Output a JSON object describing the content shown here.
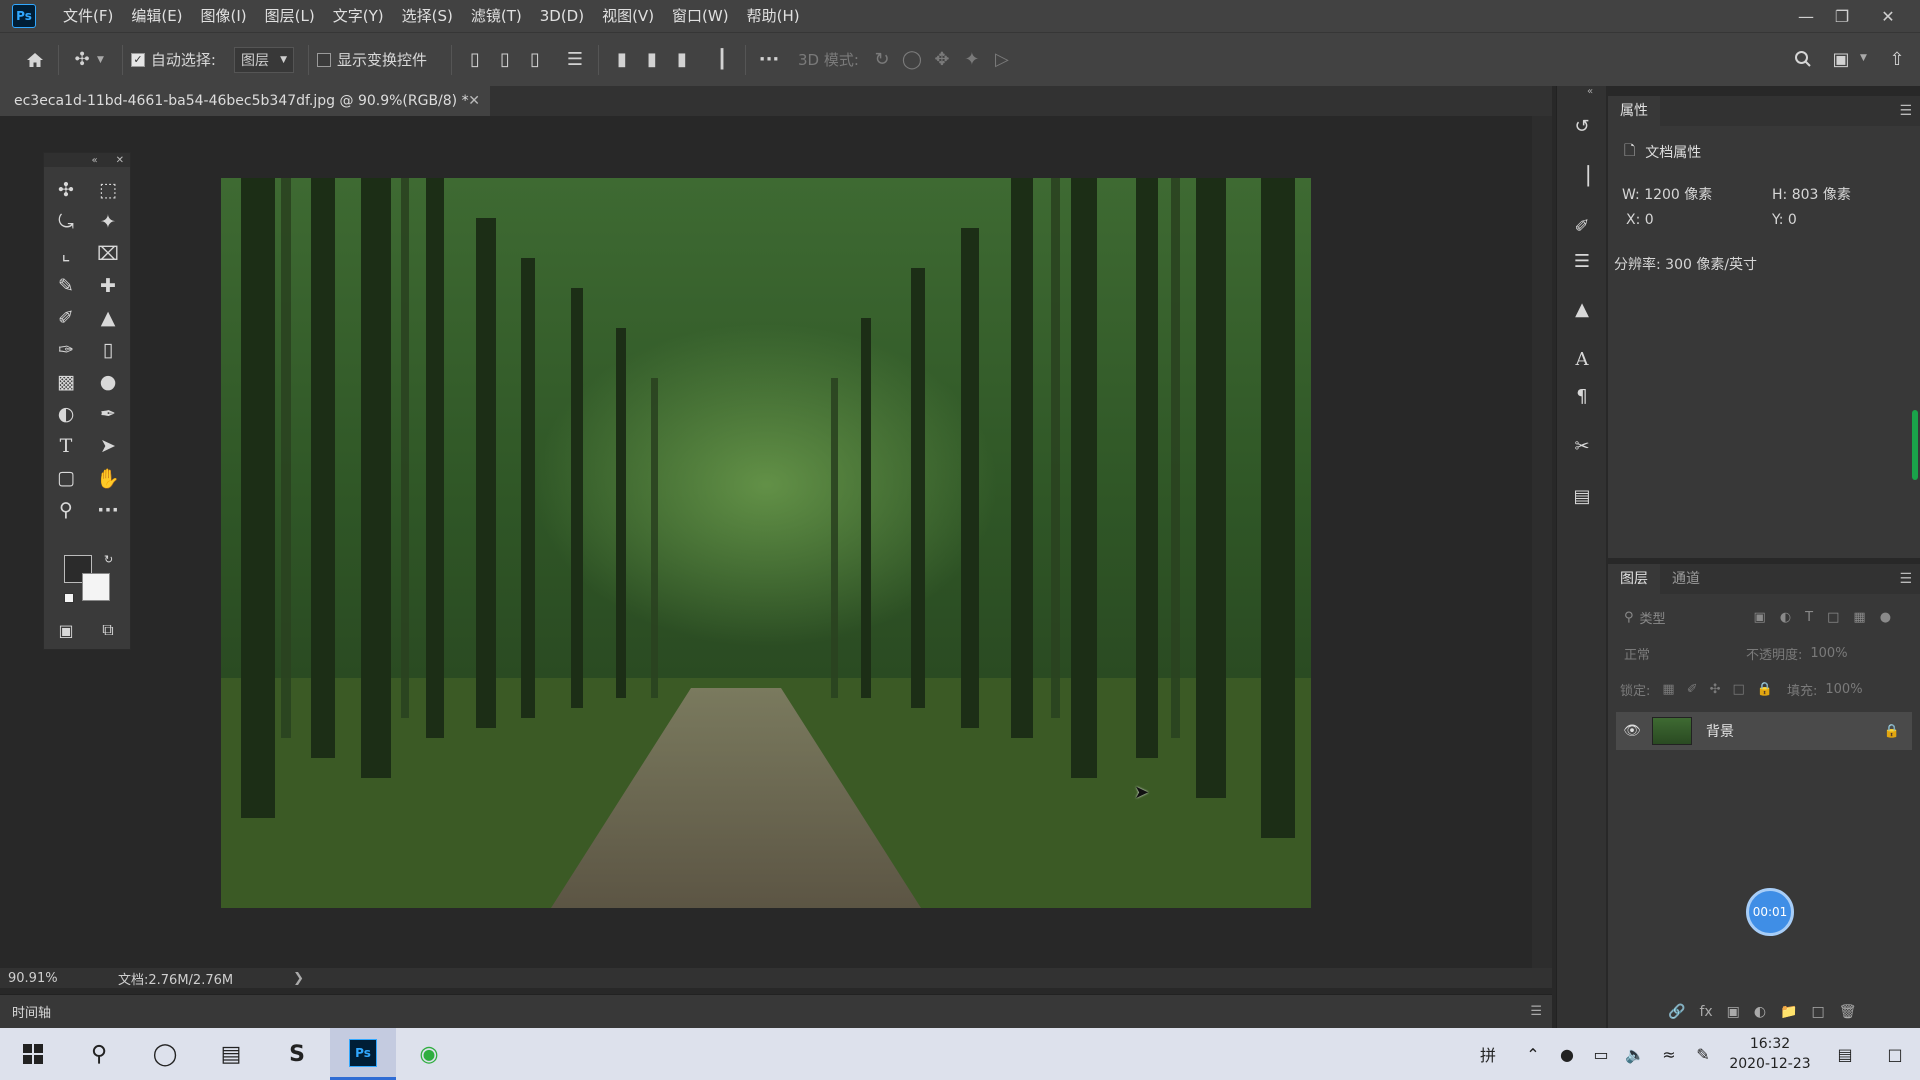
{
  "app": {
    "logo": "Ps"
  },
  "menu": [
    "文件(F)",
    "编辑(E)",
    "图像(I)",
    "图层(L)",
    "文字(Y)",
    "选择(S)",
    "滤镜(T)",
    "3D(D)",
    "视图(V)",
    "窗口(W)",
    "帮助(H)"
  ],
  "options": {
    "auto_select_label": "自动选择:",
    "auto_select_checked": true,
    "auto_select_target": "图层",
    "show_transform_label": "显示变换控件",
    "show_transform_checked": false,
    "mode_3d_label": "3D 模式:"
  },
  "document": {
    "tab_title": "ec3eca1d-11bd-4661-ba54-46bec5b347df.jpg @ 90.9%(RGB/8) *",
    "zoom": "90.91%",
    "doc_size": "文档:2.76M/2.76M"
  },
  "timeline_label": "时间轴",
  "properties": {
    "tab": "属性",
    "section": "文档属性",
    "w_label": "W:",
    "w_value": "1200 像素",
    "h_label": "H:",
    "h_value": "803 像素",
    "x_label": "X:",
    "x_value": "0",
    "y_label": "Y:",
    "y_value": "0",
    "resolution": "分辨率: 300 像素/英寸"
  },
  "layers": {
    "tab_layers": "图层",
    "tab_channels": "通道",
    "filter_placeholder": "类型",
    "blend_mode": "正常",
    "opacity_label": "不透明度:",
    "opacity_value": "100%",
    "lock_label": "锁定:",
    "fill_label": "填充:",
    "fill_value": "100%",
    "items": [
      {
        "name": "背景",
        "visible": true,
        "locked": true
      }
    ]
  },
  "timer_badge": "00:01",
  "taskbar": {
    "time": "16:32",
    "date": "2020-12-23",
    "ime": "拼"
  },
  "colors": {
    "ps_blue": "#31a8ff",
    "ui_dark": "#424242",
    "canvas_bg": "#282828",
    "badge_blue": "#3f8ee6",
    "taskbar_bg": "#dde1ec"
  }
}
